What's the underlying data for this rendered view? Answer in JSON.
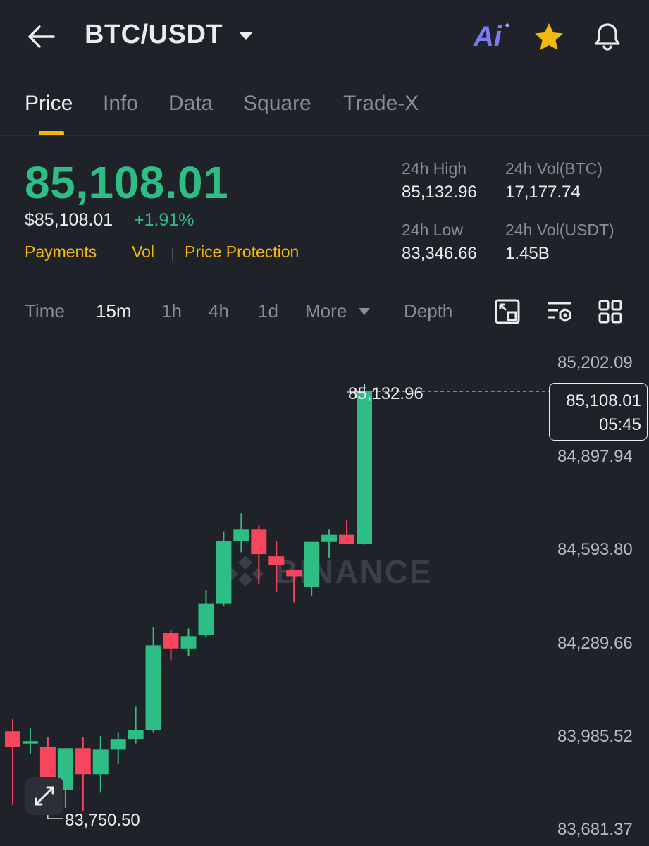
{
  "header": {
    "pair": "BTC/USDT",
    "ai_label": "Ai",
    "icons": [
      "back-arrow-icon",
      "caret-down-icon",
      "ai-icon",
      "star-icon",
      "bell-icon"
    ]
  },
  "tabs": [
    {
      "label": "Price",
      "active": true
    },
    {
      "label": "Info",
      "active": false
    },
    {
      "label": "Data",
      "active": false
    },
    {
      "label": "Square",
      "active": false
    },
    {
      "label": "Trade-X",
      "active": false
    }
  ],
  "price": {
    "last": "85,108.01",
    "usd": "$85,108.01",
    "change": "+1.91%",
    "links": [
      "Payments",
      "Vol",
      "Price Protection"
    ]
  },
  "stats": {
    "high_label": "24h High",
    "high": "85,132.96",
    "vol_btc_label": "24h Vol(BTC)",
    "vol_btc": "17,177.74",
    "low_label": "24h Low",
    "low": "83,346.66",
    "vol_usdt_label": "24h Vol(USDT)",
    "vol_usdt": "1.45B"
  },
  "intervals": {
    "items": [
      "Time",
      "15m",
      "1h",
      "4h",
      "1d",
      "More"
    ],
    "active": "15m",
    "depth": "Depth",
    "tool_icons": [
      "chart-resize-icon",
      "indicator-settings-icon",
      "grid-layout-icon"
    ]
  },
  "chart": {
    "watermark": "BINANCE",
    "y_ticks": [
      "85,202.09",
      "84,897.94",
      "84,593.80",
      "84,289.66",
      "83,985.52",
      "83,681.37"
    ],
    "current_price": "85,108.01",
    "countdown": "05:45",
    "high_marker": "85,132.96",
    "low_marker": "83,750.50",
    "colors": {
      "up": "#2ebd85",
      "down": "#f6465d"
    }
  },
  "chart_data": {
    "type": "candlestick",
    "ylim": [
      83681.37,
      85202.09
    ],
    "candles": [
      {
        "o": 84000,
        "h": 84040,
        "l": 83760,
        "c": 83950
      },
      {
        "o": 83960,
        "h": 84010,
        "l": 83925,
        "c": 83968
      },
      {
        "o": 83950,
        "h": 83980,
        "l": 83860,
        "c": 83810
      },
      {
        "o": 83810,
        "h": 83930,
        "l": 83750.5,
        "c": 83945
      },
      {
        "o": 83945,
        "h": 83980,
        "l": 83740,
        "c": 83860
      },
      {
        "o": 83860,
        "h": 83985,
        "l": 83800,
        "c": 83940
      },
      {
        "o": 83940,
        "h": 83995,
        "l": 83895,
        "c": 83975
      },
      {
        "o": 83975,
        "h": 84080,
        "l": 83960,
        "c": 84005
      },
      {
        "o": 84005,
        "h": 84340,
        "l": 83995,
        "c": 84280
      },
      {
        "o": 84320,
        "h": 84330,
        "l": 84232,
        "c": 84270
      },
      {
        "o": 84270,
        "h": 84335,
        "l": 84245,
        "c": 84310
      },
      {
        "o": 84315,
        "h": 84460,
        "l": 84305,
        "c": 84415
      },
      {
        "o": 84415,
        "h": 84652,
        "l": 84407,
        "c": 84620
      },
      {
        "o": 84620,
        "h": 84710,
        "l": 84583,
        "c": 84657
      },
      {
        "o": 84657,
        "h": 84670,
        "l": 84480,
        "c": 84577
      },
      {
        "o": 84570,
        "h": 84618,
        "l": 84453,
        "c": 84541
      },
      {
        "o": 84525,
        "h": 84495,
        "l": 84420,
        "c": 84505
      },
      {
        "o": 84470,
        "h": 84613,
        "l": 84440,
        "c": 84617
      },
      {
        "o": 84617,
        "h": 84657,
        "l": 84565,
        "c": 84640
      },
      {
        "o": 84640,
        "h": 84690,
        "l": 84615,
        "c": 84611
      },
      {
        "o": 84611,
        "h": 85132.96,
        "l": 84608,
        "c": 85108.01
      }
    ]
  }
}
